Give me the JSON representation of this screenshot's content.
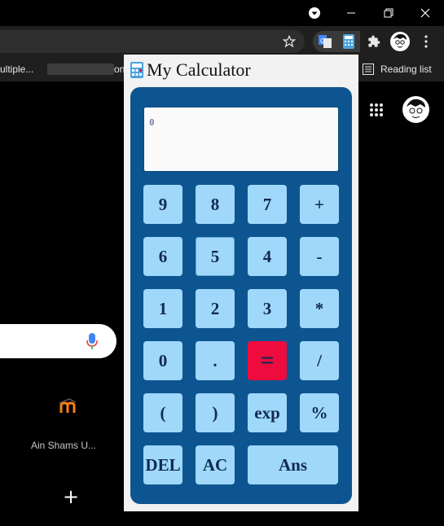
{
  "browser": {
    "tabs_partial": "ultiple...",
    "reading_list": "Reading list",
    "partial_bookmark": "on",
    "icons": [
      "profile-dropdown-icon",
      "minimize-icon",
      "restore-icon",
      "close-icon",
      "bookmark-star-icon",
      "translate-icon",
      "calculator-extension-icon",
      "puzzle-extensions-icon",
      "profile-avatar-icon",
      "more-vert-icon",
      "reading-list-icon",
      "apps-grid-icon",
      "mic-icon",
      "moodle-icon",
      "add-shortcut-icon"
    ]
  },
  "ntp": {
    "shortcut_label": "Ain Shams U...",
    "add_label": "+"
  },
  "calculator": {
    "title": "My Calculator",
    "display_value": "0",
    "keys": [
      "9",
      "8",
      "7",
      "+",
      "6",
      "5",
      "4",
      "-",
      "1",
      "2",
      "3",
      "*",
      "0",
      ".",
      "=",
      "/",
      "(",
      ")",
      "exp",
      "%",
      "DEL",
      "AC",
      "Ans"
    ],
    "colors": {
      "body": "#0d5590",
      "key": "#9fd8fb",
      "equals": "#ee0b3d",
      "key_text": "#102a52"
    }
  }
}
